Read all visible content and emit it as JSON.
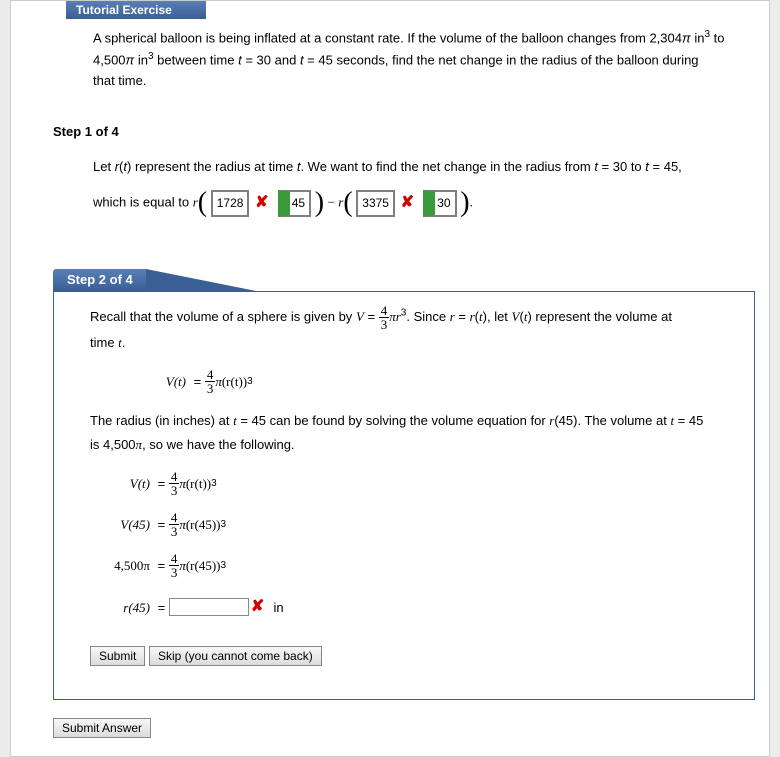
{
  "header": {
    "title": "Tutorial Exercise"
  },
  "question": {
    "line1_a": "A spherical balloon is being inflated at a constant rate. If the volume of the balloon changes from 2,304",
    "line1_b": " in",
    "line1_c": " to",
    "line2_a": "4,500",
    "line2_b": " in",
    "line2_c": " between time ",
    "line2_d": " = 30 and ",
    "line2_e": " = 45 seconds, find the net change in the radius of the balloon during",
    "line3": "that time."
  },
  "step1": {
    "label": "Step 1 of 4",
    "text_a": "Let ",
    "text_b": "r",
    "text_c": "(",
    "text_d": "t",
    "text_e": ") represent the radius at time ",
    "text_f": ". We want to find the net change in the radius from ",
    "text_g": " = 30 to ",
    "text_h": " = 45,",
    "line2": "which is equal to ",
    "ans1": "1728",
    "ans2": "45",
    "ans3": "3375",
    "ans4": "30",
    "x": "✘"
  },
  "step2": {
    "label": "Step 2 of 4",
    "p1_a": "Recall that the volume of a sphere is given by ",
    "p1_b": ". Since ",
    "p1_c": " = ",
    "p1_d": "(",
    "p1_e": "), let ",
    "p1_f": "(",
    "p1_g": ") represent the volume at",
    "p1_h": "time ",
    "p2_a": "The radius (in inches) at ",
    "p2_b": " = 45 can be found by solving the volume equation for ",
    "p2_c": "(45). The volume at ",
    "p2_d": " = 45",
    "p2_e": "is 4,500",
    "p2_f": ", so we have the following.",
    "v_label": "V",
    "t_label": "t",
    "r_label": "r",
    "pi": "π",
    "eq_vt": "V(t)",
    "eq_v45": "V(45)",
    "eq_4500": "4,500π",
    "eq_r45": "r(45)",
    "eq_rhs_rt": "(r(t))",
    "eq_rhs_r45": "(r(45))",
    "unit": "in",
    "x": "✘",
    "four": "4",
    "three": "3",
    "equals": "="
  },
  "buttons": {
    "submit": "Submit",
    "skip": "Skip (you cannot come back)",
    "submit_answer": "Submit Answer"
  }
}
